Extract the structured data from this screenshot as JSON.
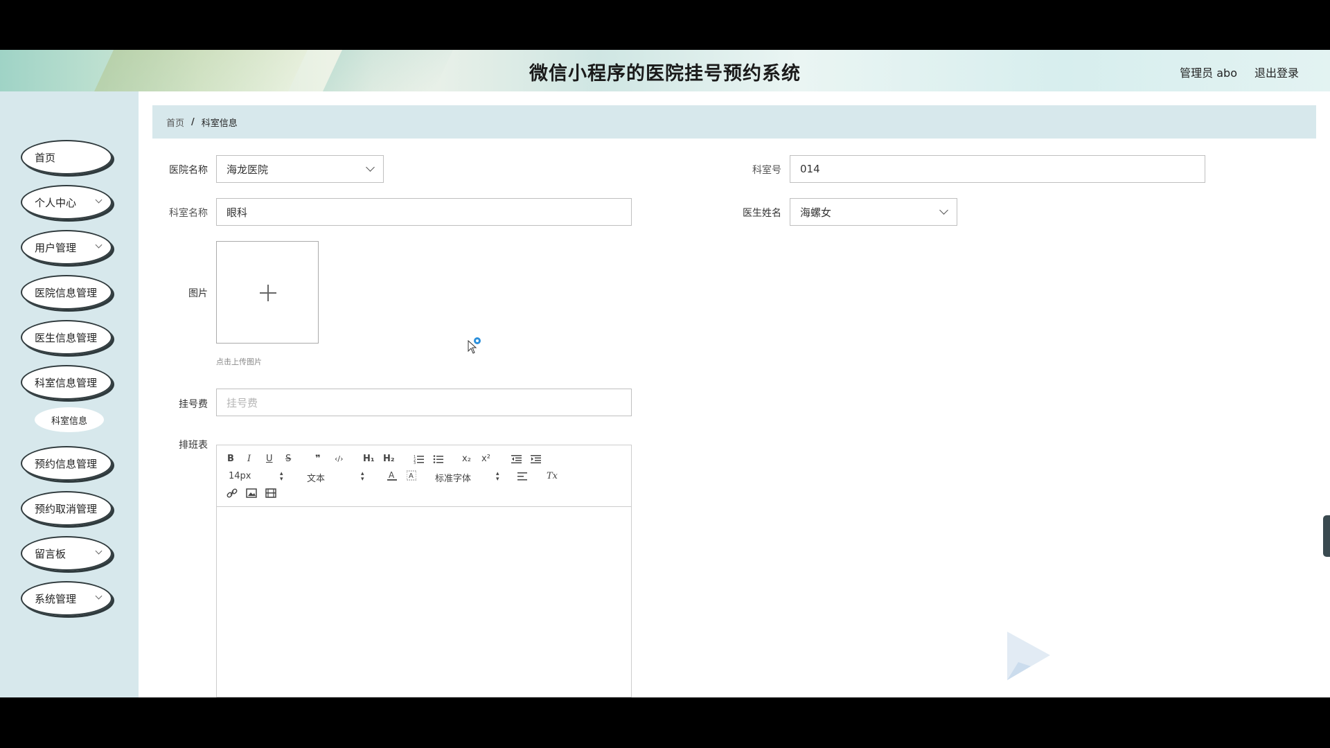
{
  "header": {
    "title": "微信小程序的医院挂号预约系统",
    "user": "管理员 abo",
    "logout": "退出登录"
  },
  "sidebar": {
    "items": [
      {
        "label": "首页",
        "has_arrow": false
      },
      {
        "label": "个人中心",
        "has_arrow": true
      },
      {
        "label": "用户管理",
        "has_arrow": true
      },
      {
        "label": "医院信息管理",
        "has_arrow": false
      },
      {
        "label": "医生信息管理",
        "has_arrow": false
      },
      {
        "label": "科室信息管理",
        "has_arrow": false
      },
      {
        "label": "预约信息管理",
        "has_arrow": false
      },
      {
        "label": "预约取消管理",
        "has_arrow": false
      },
      {
        "label": "留言板",
        "has_arrow": true
      },
      {
        "label": "系统管理",
        "has_arrow": true
      }
    ],
    "sub_item": "科室信息"
  },
  "breadcrumb": {
    "home": "首页",
    "separator": "/",
    "current": "科室信息"
  },
  "form": {
    "hospital_label": "医院名称",
    "hospital_value": "海龙医院",
    "dept_no_label": "科室号",
    "dept_no_value": "014",
    "dept_name_label": "科室名称",
    "dept_name_value": "眼科",
    "doctor_label": "医生姓名",
    "doctor_value": "海螺女",
    "image_label": "图片",
    "upload_hint": "点击上传图片",
    "fee_label": "挂号费",
    "fee_placeholder": "挂号费",
    "schedule_label": "排班表"
  },
  "editor": {
    "font_size": "14px",
    "header_select": "文本",
    "font_family": "标准字体",
    "buttons": {
      "bold": "B",
      "italic": "I",
      "underline": "U",
      "strike": "S",
      "quote": "❞",
      "code": "‹/›",
      "h1": "H₁",
      "h2": "H₂",
      "sub": "x₂",
      "sup": "x²",
      "clear": "Tx"
    }
  },
  "colors": {
    "sidebar_bg": "#d7e8ec",
    "breadcrumb_bg": "#d7e8ec",
    "nav_border": "#2f3a3d",
    "spinner": "#2b8fdb"
  }
}
